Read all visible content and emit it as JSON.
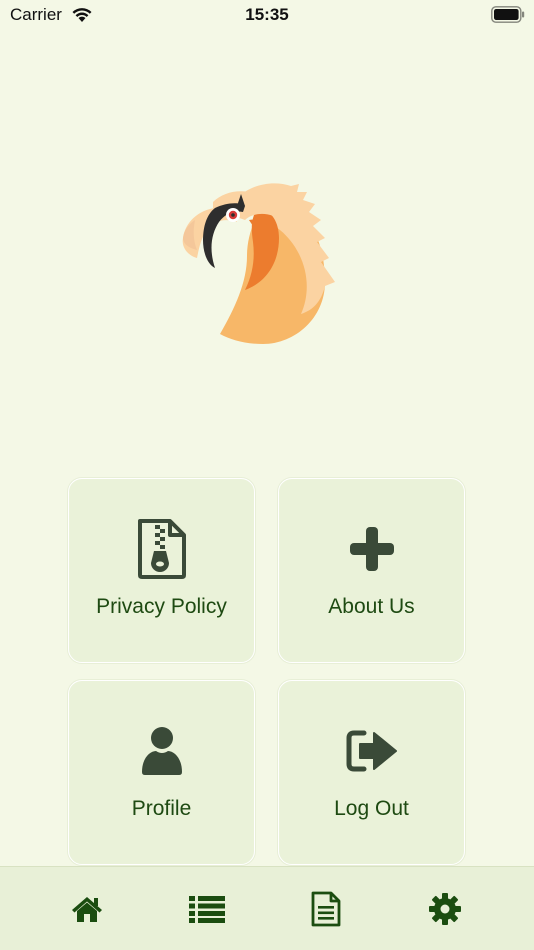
{
  "status_bar": {
    "carrier": "Carrier",
    "time": "15:35"
  },
  "app": {
    "logo": "vulture-head-logo"
  },
  "menu": {
    "tiles": [
      {
        "label": "Privacy Policy",
        "icon": "zip-file-icon"
      },
      {
        "label": "About Us",
        "icon": "plus-icon"
      },
      {
        "label": "Profile",
        "icon": "user-icon"
      },
      {
        "label": "Log Out",
        "icon": "sign-out-icon"
      }
    ]
  },
  "tab_bar": {
    "items": [
      {
        "icon": "home-icon"
      },
      {
        "icon": "list-icon"
      },
      {
        "icon": "document-icon"
      },
      {
        "icon": "gear-icon"
      }
    ]
  },
  "colors": {
    "background": "#f4f8e6",
    "tile_background": "#eaf2d9",
    "tile_icon": "#3a4a38",
    "tile_text": "#1e4a12",
    "tab_icon": "#1b4d10",
    "tab_bar_background": "#e8f0d7"
  }
}
